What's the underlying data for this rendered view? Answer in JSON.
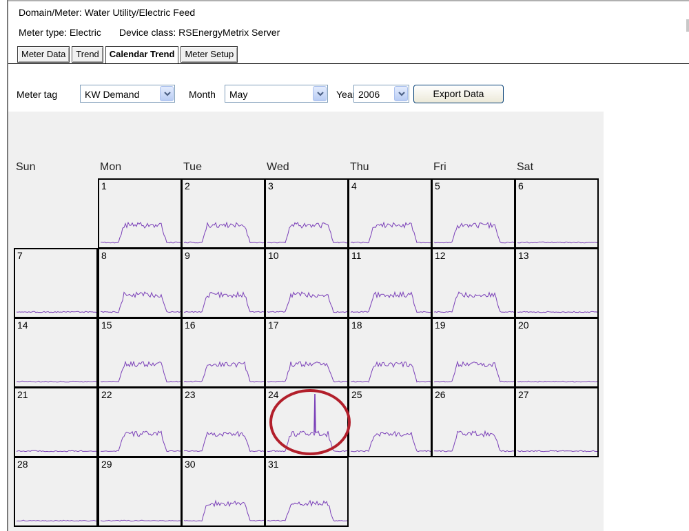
{
  "header": {
    "domain_line": "Domain/Meter: Water Utility/Electric Feed",
    "meter_type_line": "Meter type: Electric",
    "device_class_line": "Device class: RSEnergyMetrix Server"
  },
  "tabs": [
    {
      "label": "Meter Data",
      "active": false
    },
    {
      "label": "Trend",
      "active": false
    },
    {
      "label": "Calendar Trend",
      "active": true
    },
    {
      "label": "Meter Setup",
      "active": false
    }
  ],
  "toolbar": {
    "meter_tag_label": "Meter tag",
    "meter_tag_value": "KW Demand",
    "month_label": "Month",
    "month_value": "May",
    "year_label": "Year",
    "year_value": "2006",
    "export_label": "Export Data"
  },
  "calendar": {
    "weekdays": [
      "Sun",
      "Mon",
      "Tue",
      "Wed",
      "Thu",
      "Fri",
      "Sat"
    ],
    "first_weekday_index": 1,
    "days": [
      {
        "day": "1",
        "profile": "weekday"
      },
      {
        "day": "2",
        "profile": "weekday"
      },
      {
        "day": "3",
        "profile": "weekday"
      },
      {
        "day": "4",
        "profile": "weekday"
      },
      {
        "day": "5",
        "profile": "weekday"
      },
      {
        "day": "6",
        "profile": "weekend"
      },
      {
        "day": "7",
        "profile": "weekend"
      },
      {
        "day": "8",
        "profile": "weekday"
      },
      {
        "day": "9",
        "profile": "weekday"
      },
      {
        "day": "10",
        "profile": "weekday"
      },
      {
        "day": "11",
        "profile": "weekday"
      },
      {
        "day": "12",
        "profile": "weekday"
      },
      {
        "day": "13",
        "profile": "weekend"
      },
      {
        "day": "14",
        "profile": "weekend"
      },
      {
        "day": "15",
        "profile": "weekday"
      },
      {
        "day": "16",
        "profile": "weekday"
      },
      {
        "day": "17",
        "profile": "weekday"
      },
      {
        "day": "18",
        "profile": "weekday"
      },
      {
        "day": "19",
        "profile": "weekday"
      },
      {
        "day": "20",
        "profile": "weekend"
      },
      {
        "day": "21",
        "profile": "weekend"
      },
      {
        "day": "22",
        "profile": "weekday"
      },
      {
        "day": "23",
        "profile": "weekday"
      },
      {
        "day": "24",
        "profile": "spike"
      },
      {
        "day": "25",
        "profile": "weekday"
      },
      {
        "day": "26",
        "profile": "weekday"
      },
      {
        "day": "27",
        "profile": "weekend"
      },
      {
        "day": "28",
        "profile": "weekend"
      },
      {
        "day": "29",
        "profile": "weekend"
      },
      {
        "day": "30",
        "profile": "weekday"
      },
      {
        "day": "31",
        "profile": "weekday"
      }
    ],
    "trace_color": "#7a3fb8",
    "highlight_color": "#b21f2b",
    "highlighted_day": "24"
  }
}
